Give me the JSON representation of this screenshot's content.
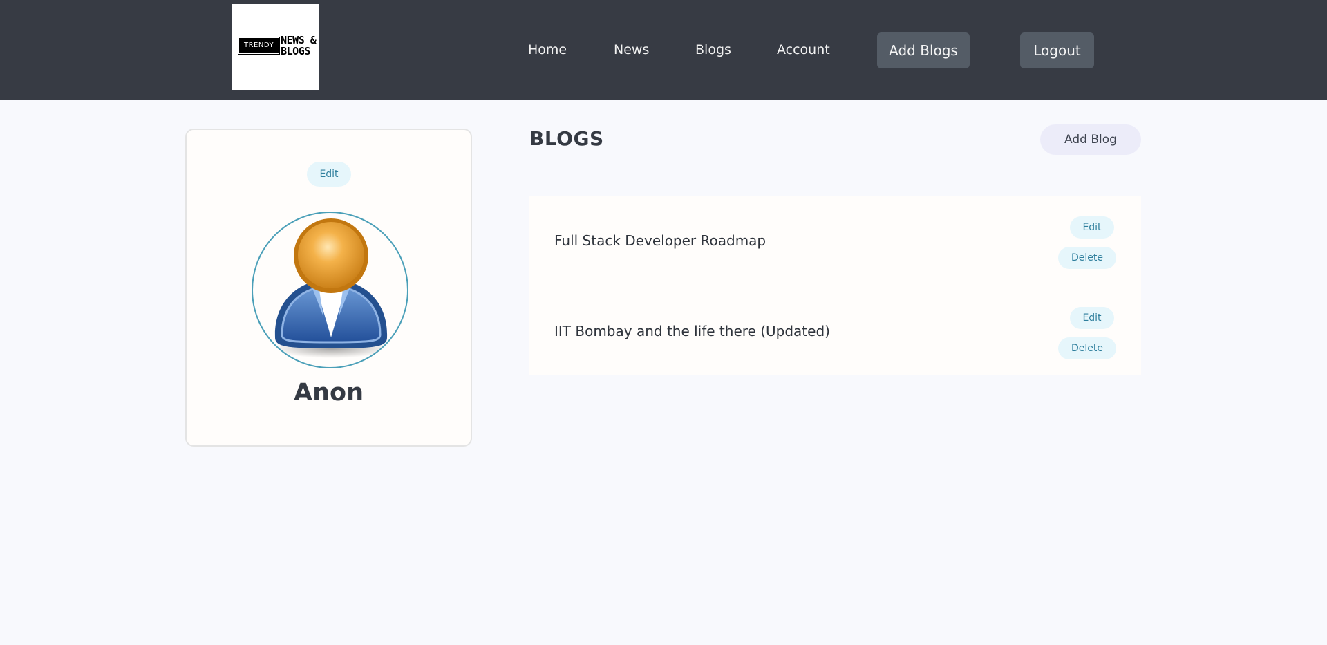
{
  "header": {
    "logo": {
      "tag_text": "TRENDY",
      "words_line1": "NEWS &",
      "words_line2": "BLOGS"
    },
    "nav": [
      "Home",
      "News",
      "Blogs",
      "Account"
    ],
    "add_blogs_label": "Add Blogs",
    "logout_label": "Logout"
  },
  "profile": {
    "edit_label": "Edit",
    "avatar_icon": "user-avatar-icon",
    "name": "Anon"
  },
  "blogs": {
    "title": "BLOGS",
    "add_label": "Add Blog",
    "items": [
      {
        "title": "Full Stack Developer Roadmap",
        "edit_label": "Edit",
        "delete_label": "Delete"
      },
      {
        "title": "IIT Bombay and the life there (Updated)",
        "edit_label": "Edit",
        "delete_label": "Delete"
      }
    ]
  },
  "colors": {
    "header_bg": "#373b44",
    "page_bg": "#f8f9fd",
    "accent_pill_bg": "#e6f6fb",
    "accent_text": "#2f7f9d"
  }
}
